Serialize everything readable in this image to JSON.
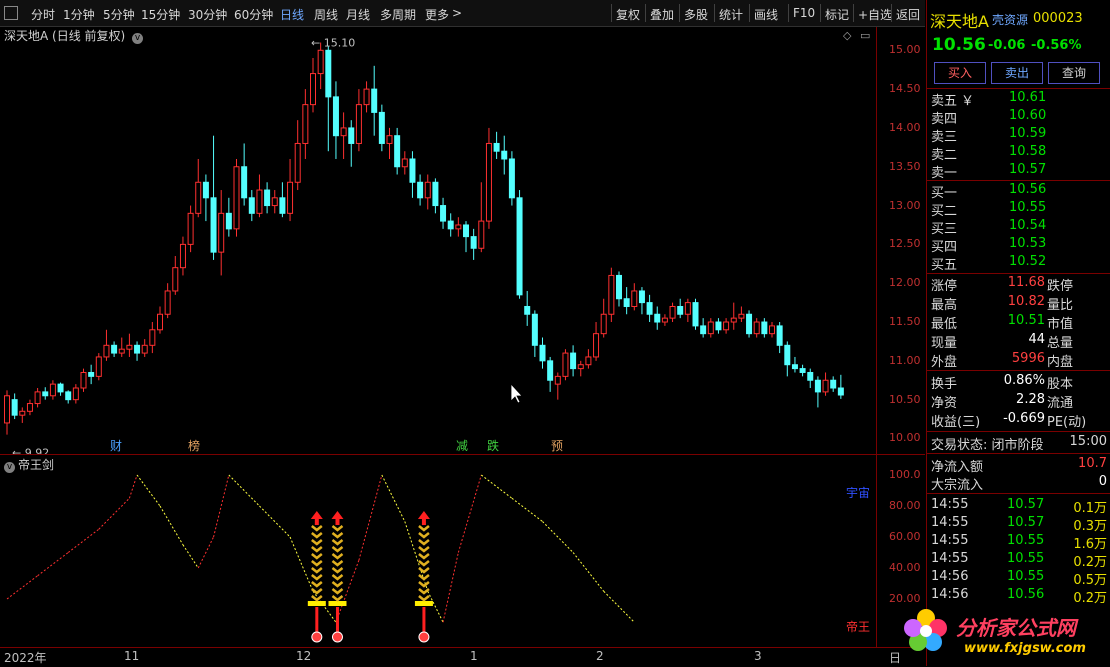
{
  "toolbar": {
    "periods": [
      "分时",
      "1分钟",
      "5分钟",
      "15分钟",
      "30分钟",
      "60分钟",
      "日线",
      "周线",
      "月线",
      "多周期",
      "更多"
    ],
    "tools": [
      "复权",
      "叠加",
      "多股",
      "统计",
      "画线",
      "F10",
      "标记",
      "+自选",
      "返回"
    ]
  },
  "chart": {
    "header": "深天地A (日线 前复权)",
    "high_label": "15.10",
    "low_label": "9.92",
    "y_ticks": [
      "15.00",
      "14.50",
      "14.00",
      "13.50",
      "13.00",
      "12.50",
      "12.00",
      "11.50",
      "11.00",
      "10.50",
      "10.00"
    ],
    "events": [
      {
        "label": "财",
        "color": "#4aa0ff"
      },
      {
        "label": "榜",
        "color": "#e0a060"
      },
      {
        "label": "减",
        "color": "#40d040"
      },
      {
        "label": "跌",
        "color": "#40d040"
      },
      {
        "label": "预",
        "color": "#e0a060"
      }
    ],
    "up_color": "#ff3030",
    "down_color": "#54ffff"
  },
  "indicator": {
    "name": "帝王剑",
    "y_ticks": [
      "100.0",
      "80.00",
      "60.00",
      "40.00",
      "20.00"
    ],
    "label_top": "宇宙",
    "label_bottom": "帝王"
  },
  "xaxis": {
    "labels": [
      "2022年",
      "11",
      "12",
      "1",
      "2",
      "3"
    ],
    "corner": "日"
  },
  "panel": {
    "name": "深天地A",
    "badge": "壳资源",
    "code": "000023",
    "price": "10.56",
    "change": "-0.06",
    "pct": "-0.56%",
    "buttons": [
      "买入",
      "卖出",
      "查询"
    ],
    "asks": [
      {
        "label": "卖五",
        "extra": "￥",
        "price": "10.61"
      },
      {
        "label": "卖四",
        "extra": "",
        "price": "10.60"
      },
      {
        "label": "卖三",
        "extra": "",
        "price": "10.59"
      },
      {
        "label": "卖二",
        "extra": "",
        "price": "10.58"
      },
      {
        "label": "卖一",
        "extra": "",
        "price": "10.57"
      }
    ],
    "bids": [
      {
        "label": "买一",
        "price": "10.56"
      },
      {
        "label": "买二",
        "price": "10.55"
      },
      {
        "label": "买三",
        "price": "10.54"
      },
      {
        "label": "买四",
        "price": "10.53"
      },
      {
        "label": "买五",
        "price": "10.52"
      }
    ],
    "stats": [
      {
        "label": "涨停",
        "value": "11.68",
        "color": "#ff4040",
        "right": "跌停"
      },
      {
        "label": "最高",
        "value": "10.82",
        "color": "#ff4040",
        "right": "量比"
      },
      {
        "label": "最低",
        "value": "10.51",
        "color": "#00e000",
        "right": "市值"
      },
      {
        "label": "现量",
        "value": "44",
        "color": "#ffffff",
        "right": "总量"
      },
      {
        "label": "外盘",
        "value": "5996",
        "color": "#ff4040",
        "right": "内盘"
      }
    ],
    "stats2": [
      {
        "label": "换手",
        "value": "0.86%",
        "right": "股本"
      },
      {
        "label": "净资",
        "value": "2.28",
        "right": "流通"
      },
      {
        "label": "收益(三)",
        "value": "-0.669",
        "right": "PE(动)"
      }
    ],
    "status_label": "交易状态: 闭市阶段",
    "status_time": "15:00",
    "flow": [
      {
        "label": "净流入额",
        "value": "10.7"
      },
      {
        "label": "大宗流入",
        "value": "0"
      }
    ],
    "ticks": [
      {
        "time": "14:55",
        "price": "10.57",
        "vol": "0.1万"
      },
      {
        "time": "14:55",
        "price": "10.57",
        "vol": "0.3万"
      },
      {
        "time": "14:55",
        "price": "10.55",
        "vol": "1.6万"
      },
      {
        "time": "14:55",
        "price": "10.55",
        "vol": "0.2万"
      },
      {
        "time": "14:56",
        "price": "10.55",
        "vol": "0.5万"
      },
      {
        "time": "14:56",
        "price": "10.56",
        "vol": "0.2万"
      }
    ]
  },
  "watermark": {
    "title": "分析家公式网",
    "url": "www.fxjgsw.com"
  },
  "candles": [
    [
      10.2,
      10.55,
      10.05,
      10.62
    ],
    [
      10.5,
      10.3,
      10.25,
      10.58
    ],
    [
      10.3,
      10.35,
      10.2,
      10.4
    ],
    [
      10.35,
      10.45,
      10.3,
      10.5
    ],
    [
      10.45,
      10.6,
      10.4,
      10.65
    ],
    [
      10.6,
      10.55,
      10.5,
      10.66
    ],
    [
      10.55,
      10.7,
      10.5,
      10.75
    ],
    [
      10.7,
      10.6,
      10.55,
      10.72
    ],
    [
      10.6,
      10.5,
      10.45,
      10.62
    ],
    [
      10.5,
      10.65,
      10.45,
      10.7
    ],
    [
      10.65,
      10.85,
      10.6,
      10.9
    ],
    [
      10.85,
      10.8,
      10.7,
      10.95
    ],
    [
      10.8,
      11.05,
      10.75,
      11.1
    ],
    [
      11.05,
      11.2,
      11.0,
      11.4
    ],
    [
      11.2,
      11.1,
      11.05,
      11.25
    ],
    [
      11.1,
      11.15,
      11.05,
      11.3
    ],
    [
      11.15,
      11.2,
      11.05,
      11.35
    ],
    [
      11.2,
      11.1,
      11.0,
      11.25
    ],
    [
      11.1,
      11.2,
      11.05,
      11.28
    ],
    [
      11.2,
      11.4,
      11.1,
      11.5
    ],
    [
      11.4,
      11.6,
      11.35,
      11.7
    ],
    [
      11.6,
      11.9,
      11.55,
      12.0
    ],
    [
      11.9,
      12.2,
      11.85,
      12.35
    ],
    [
      12.2,
      12.5,
      12.1,
      12.6
    ],
    [
      12.5,
      12.9,
      12.4,
      13.0
    ],
    [
      12.9,
      13.3,
      12.85,
      13.6
    ],
    [
      13.3,
      13.1,
      12.8,
      13.4
    ],
    [
      13.1,
      12.4,
      12.3,
      13.9
    ],
    [
      12.4,
      12.9,
      12.1,
      13.2
    ],
    [
      12.9,
      12.7,
      12.6,
      13.1
    ],
    [
      12.7,
      13.5,
      12.6,
      13.6
    ],
    [
      13.5,
      13.1,
      13.0,
      13.8
    ],
    [
      13.1,
      12.9,
      12.8,
      13.2
    ],
    [
      12.9,
      13.2,
      12.85,
      13.4
    ],
    [
      13.2,
      13.0,
      12.9,
      13.3
    ],
    [
      13.0,
      13.1,
      12.9,
      13.2
    ],
    [
      13.1,
      12.9,
      12.85,
      13.3
    ],
    [
      12.9,
      13.3,
      12.8,
      13.6
    ],
    [
      13.3,
      13.8,
      13.2,
      14.1
    ],
    [
      13.8,
      14.3,
      13.6,
      14.5
    ],
    [
      14.3,
      14.7,
      14.2,
      14.9
    ],
    [
      14.7,
      15.0,
      14.5,
      15.1
    ],
    [
      15.0,
      14.4,
      13.7,
      15.05
    ],
    [
      14.4,
      13.9,
      13.6,
      14.6
    ],
    [
      13.9,
      14.0,
      13.6,
      14.2
    ],
    [
      14.0,
      13.8,
      13.5,
      14.1
    ],
    [
      13.8,
      14.3,
      13.7,
      14.5
    ],
    [
      14.3,
      14.5,
      14.2,
      14.6
    ],
    [
      14.5,
      14.2,
      13.9,
      14.8
    ],
    [
      14.2,
      13.8,
      13.7,
      14.3
    ],
    [
      13.8,
      13.9,
      13.6,
      14.0
    ],
    [
      13.9,
      13.5,
      13.4,
      14.0
    ],
    [
      13.5,
      13.6,
      13.4,
      13.7
    ],
    [
      13.6,
      13.3,
      13.1,
      13.7
    ],
    [
      13.3,
      13.1,
      13.0,
      13.4
    ],
    [
      13.1,
      13.3,
      12.95,
      13.4
    ],
    [
      13.3,
      13.0,
      12.9,
      13.35
    ],
    [
      13.0,
      12.8,
      12.7,
      13.1
    ],
    [
      12.8,
      12.7,
      12.6,
      12.9
    ],
    [
      12.7,
      12.75,
      12.6,
      12.85
    ],
    [
      12.75,
      12.6,
      12.4,
      12.8
    ],
    [
      12.6,
      12.45,
      12.3,
      12.7
    ],
    [
      12.45,
      12.8,
      12.4,
      13.3
    ],
    [
      12.8,
      13.8,
      12.7,
      14.0
    ],
    [
      13.8,
      13.7,
      13.6,
      13.95
    ],
    [
      13.7,
      13.6,
      13.4,
      13.9
    ],
    [
      13.6,
      13.1,
      13.0,
      13.7
    ],
    [
      13.1,
      11.85,
      11.8,
      13.2
    ],
    [
      11.7,
      11.6,
      11.45,
      11.9
    ],
    [
      11.6,
      11.2,
      11.05,
      11.65
    ],
    [
      11.2,
      11.0,
      10.9,
      11.3
    ],
    [
      11.0,
      10.75,
      10.6,
      11.05
    ],
    [
      10.7,
      10.8,
      10.5,
      10.85
    ],
    [
      10.8,
      11.1,
      10.75,
      11.15
    ],
    [
      11.1,
      10.9,
      10.8,
      11.2
    ],
    [
      10.9,
      10.95,
      10.8,
      11.0
    ],
    [
      10.95,
      11.05,
      10.9,
      11.15
    ],
    [
      11.05,
      11.35,
      11.0,
      11.5
    ],
    [
      11.35,
      11.6,
      11.3,
      11.8
    ],
    [
      11.6,
      12.1,
      11.5,
      12.2
    ],
    [
      12.1,
      11.8,
      11.7,
      12.15
    ],
    [
      11.8,
      11.7,
      11.6,
      11.95
    ],
    [
      11.7,
      11.9,
      11.65,
      12.0
    ],
    [
      11.9,
      11.75,
      11.6,
      11.95
    ],
    [
      11.75,
      11.6,
      11.5,
      11.85
    ],
    [
      11.6,
      11.5,
      11.4,
      11.7
    ],
    [
      11.5,
      11.55,
      11.45,
      11.6
    ],
    [
      11.55,
      11.7,
      11.5,
      11.75
    ],
    [
      11.7,
      11.6,
      11.55,
      11.8
    ],
    [
      11.6,
      11.75,
      11.5,
      11.8
    ],
    [
      11.75,
      11.45,
      11.4,
      11.8
    ],
    [
      11.45,
      11.35,
      11.3,
      11.55
    ],
    [
      11.35,
      11.5,
      11.3,
      11.55
    ],
    [
      11.5,
      11.4,
      11.35,
      11.55
    ],
    [
      11.4,
      11.5,
      11.35,
      11.55
    ],
    [
      11.5,
      11.55,
      11.4,
      11.75
    ],
    [
      11.55,
      11.6,
      11.5,
      11.7
    ],
    [
      11.6,
      11.35,
      11.3,
      11.65
    ],
    [
      11.35,
      11.5,
      11.3,
      11.55
    ],
    [
      11.5,
      11.35,
      11.3,
      11.55
    ],
    [
      11.35,
      11.45,
      11.3,
      11.5
    ],
    [
      11.45,
      11.2,
      11.1,
      11.5
    ],
    [
      11.2,
      10.95,
      10.8,
      11.25
    ],
    [
      10.95,
      10.9,
      10.85,
      11.05
    ],
    [
      10.9,
      10.85,
      10.8,
      10.95
    ],
    [
      10.85,
      10.75,
      10.65,
      10.9
    ],
    [
      10.75,
      10.6,
      10.4,
      10.8
    ],
    [
      10.6,
      10.75,
      10.55,
      10.85
    ],
    [
      10.75,
      10.65,
      10.6,
      10.8
    ],
    [
      10.65,
      10.56,
      10.51,
      10.82
    ]
  ],
  "dmj_line": [
    [
      0,
      20
    ],
    [
      4,
      35
    ],
    [
      8,
      50
    ],
    [
      12,
      65
    ],
    [
      16,
      85
    ],
    [
      17,
      100
    ],
    [
      20,
      80
    ],
    [
      23,
      55
    ],
    [
      25,
      40
    ],
    [
      27,
      60
    ],
    [
      29,
      100
    ],
    [
      33,
      80
    ],
    [
      37,
      60
    ],
    [
      40,
      25
    ],
    [
      43,
      5
    ],
    [
      46,
      45
    ],
    [
      49,
      100
    ],
    [
      52,
      70
    ],
    [
      55,
      25
    ],
    [
      57,
      5
    ],
    [
      59,
      50
    ],
    [
      62,
      100
    ],
    [
      66,
      85
    ],
    [
      70,
      70
    ],
    [
      74,
      50
    ],
    [
      78,
      25
    ],
    [
      82,
      5
    ]
  ],
  "signals": [
    40.5,
    43.2,
    54.5
  ]
}
